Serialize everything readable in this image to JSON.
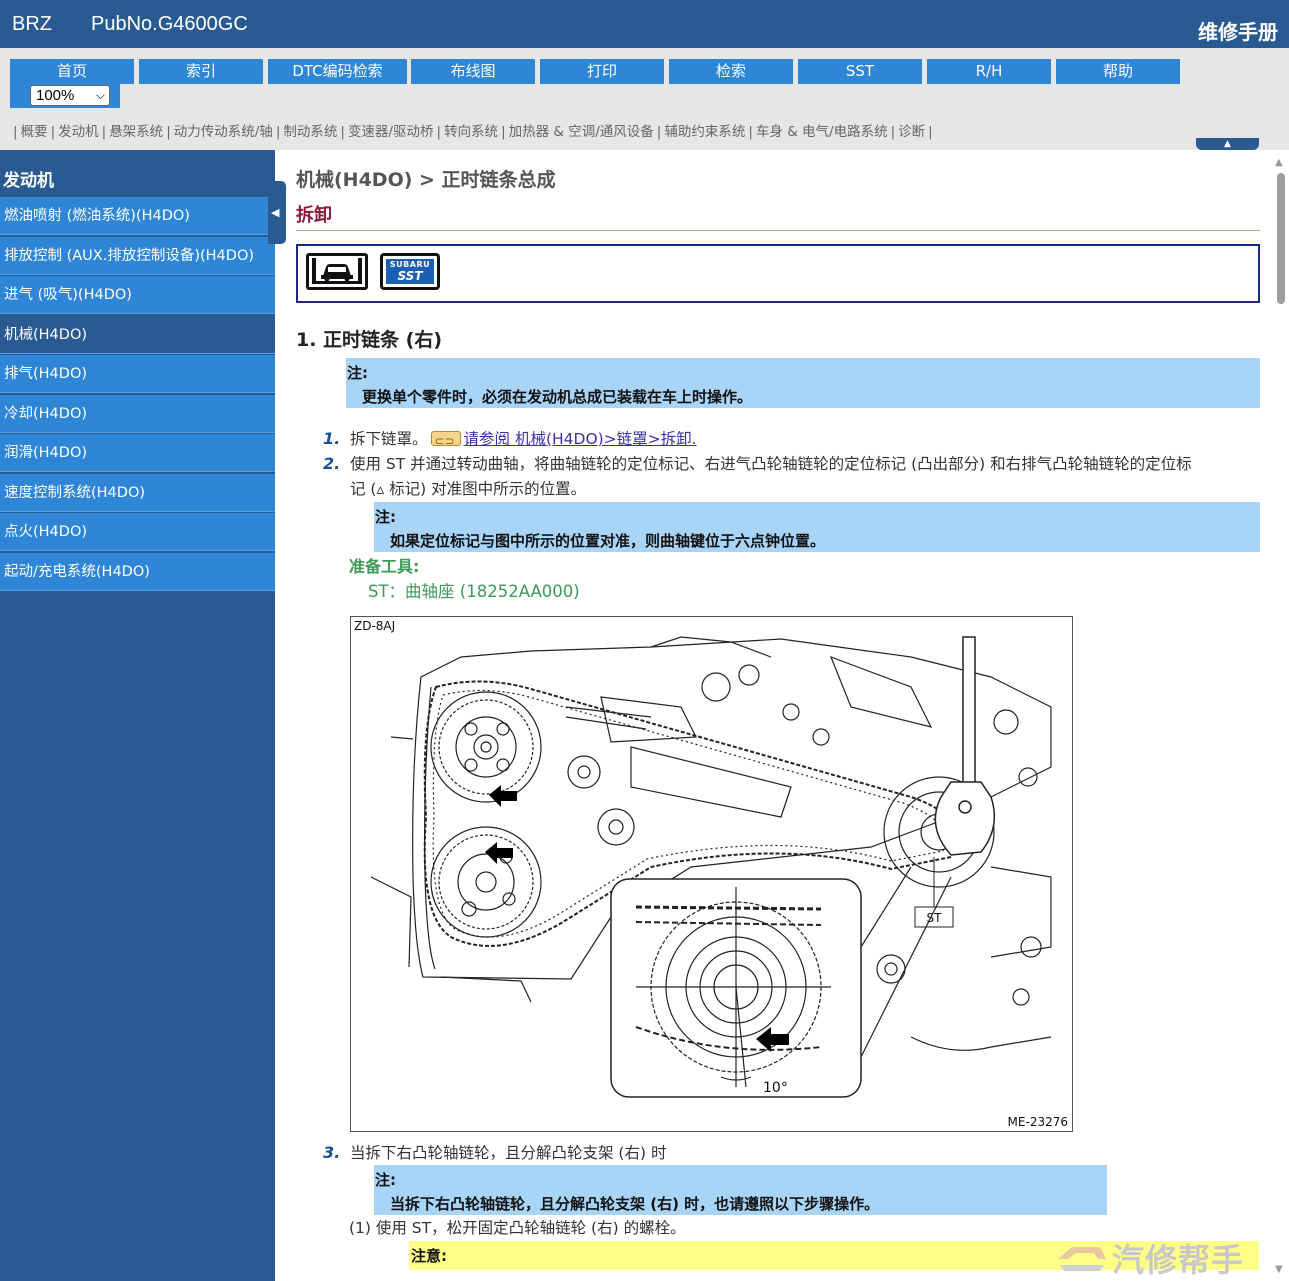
{
  "header": {
    "brand": "BRZ",
    "pubno": "PubNo.G4600GC",
    "app_title": "维修手册"
  },
  "nav": {
    "buttons": [
      "首页",
      "索引",
      "DTC编码检索",
      "布线图",
      "打印",
      "检索",
      "SST",
      "R/H",
      "帮助"
    ],
    "zoom": "100%",
    "sublinks": [
      "概要",
      "发动机",
      "悬架系统",
      "动力传动系统/轴",
      "制动系统",
      "变速器/驱动桥",
      "转向系统",
      "加热器 & 空调/通风设备",
      "辅助约束系统",
      "车身 & 电气/电路系统",
      "诊断"
    ]
  },
  "sidebar": {
    "title": "发动机",
    "items": [
      {
        "label": "燃油喷射 (燃油系统)(H4DO)",
        "active": false
      },
      {
        "label": "排放控制 (AUX.排放控制设备)(H4DO)",
        "active": false
      },
      {
        "label": "进气 (吸气)(H4DO)",
        "active": false
      },
      {
        "label": "机械(H4DO)",
        "active": true
      },
      {
        "label": "排气(H4DO)",
        "active": false
      },
      {
        "label": "冷却(H4DO)",
        "active": false
      },
      {
        "label": "润滑(H4DO)",
        "active": false
      },
      {
        "label": "速度控制系统(H4DO)",
        "active": false
      },
      {
        "label": "点火(H4DO)",
        "active": false
      },
      {
        "label": "起动/充电系统(H4DO)",
        "active": false
      }
    ]
  },
  "content": {
    "breadcrumb": "机械(H4DO) > 正时链条总成",
    "section_title": "拆卸",
    "tool_icons": [
      "lift-icon",
      "sst-icon"
    ],
    "sst_icon_text": {
      "top": "SUBARU",
      "bottom": "SST"
    },
    "heading": "1. 正时链条 (右)",
    "note1": {
      "title": "注:",
      "body": "更换单个零件时，必须在发动机总成已装载在车上时操作。"
    },
    "step1": {
      "num": "1.",
      "text": "拆下链罩。",
      "link": "请参阅 机械(H4DO)>链罩>拆卸."
    },
    "step2": {
      "num": "2.",
      "line1": "使用 ST 并通过转动曲轴，将曲轴链轮的定位标记、右进气凸轮轴链轮的定位标记 (凸出部分) 和右排气凸轮轴链轮的定位标",
      "line2": "记 (▵ 标记) 对准图中所示的位置。"
    },
    "note2": {
      "title": "注:",
      "body": "如果定位标记与图中所示的位置对准，则曲轴键位于六点钟位置。"
    },
    "prep_title": "准备工具:",
    "prep_item": "ST：曲轴座 (18252AA000)",
    "figure": {
      "id": "ZD-8AJ",
      "ref": "ME-23276",
      "st_label": "ST",
      "angle_label": "10°"
    },
    "step3": {
      "num": "3.",
      "text": "当拆下右凸轮轴链轮，且分解凸轮支架 (右) 时"
    },
    "note3": {
      "title": "注:",
      "body": "当拆下右凸轮轴链轮，且分解凸轮支架 (右) 时，也请遵照以下步骤操作。"
    },
    "substep1": "(1)  使用 ST，松开固定凸轮轴链轮 (右) 的螺栓。",
    "caution_title": "注意:"
  },
  "watermark": "汽修帮手",
  "colors": {
    "header_bg": "#2a5a92",
    "nav_button": "#2f86d6",
    "note_bg": "#a8d4f8",
    "caution_bg": "#ffff88",
    "section_title": "#8c1a3a",
    "prep_green": "#3c9a58"
  }
}
